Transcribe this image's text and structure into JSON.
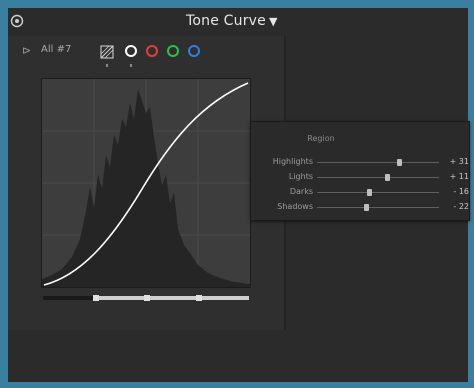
{
  "header": {
    "title": "Tone Curve",
    "menu_caret": "▼"
  },
  "toolbar": {
    "target_icon": "target-adjust-icon",
    "channel_label": "All #7",
    "point_curve_icon": "point-curve-icon",
    "channels": [
      {
        "name": "rgb",
        "color": "#ffffff"
      },
      {
        "name": "red",
        "color": "#e33d3d"
      },
      {
        "name": "green",
        "color": "#2fbf4a"
      },
      {
        "name": "blue",
        "color": "#2f7fe0"
      }
    ]
  },
  "region_popup": {
    "title": "Region",
    "rows": [
      {
        "label": "Highlights",
        "value": "+ 31",
        "level": 0.68
      },
      {
        "label": "Lights",
        "value": "+ 11",
        "level": 0.58
      },
      {
        "label": "Darks",
        "value": "- 16",
        "level": 0.43
      },
      {
        "label": "Shadows",
        "value": "- 22",
        "level": 0.4
      }
    ]
  },
  "split_points": [
    0.25,
    0.5,
    0.75
  ]
}
